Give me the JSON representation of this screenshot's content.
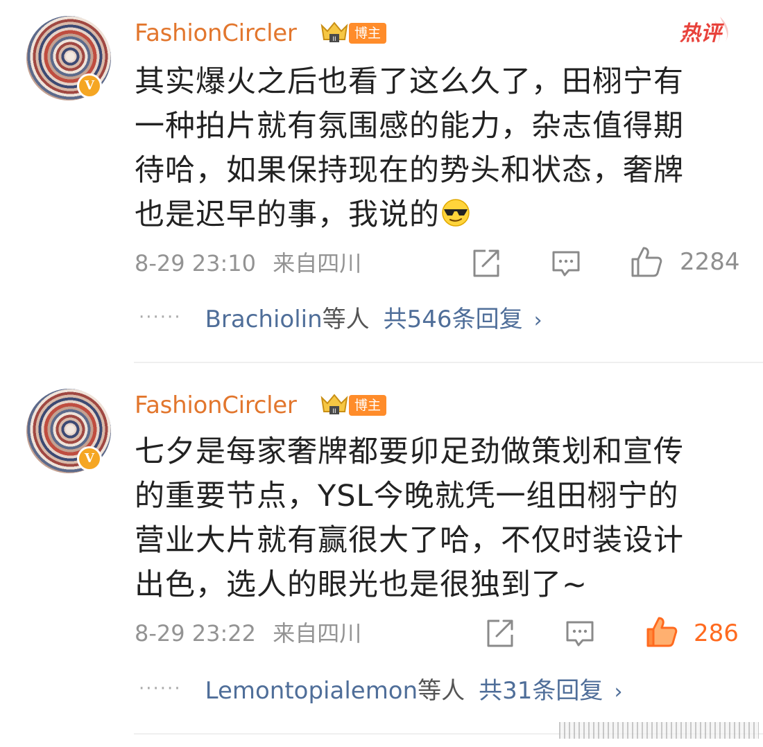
{
  "comments": [
    {
      "username": "FashionCircler",
      "badge": "博主",
      "hot_label": "热评",
      "text": "其实爆火之后也看了这么久了，田栩宁有\n一种拍片就有氛围感的能力，杂志值得期\n待哈，如果保持现在的势头和状态，奢牌\n也是迟早的事，我说的",
      "emoji": "sunglasses-emoji",
      "timestamp": "8-29 23:10",
      "location": "来自四川",
      "likes": "2284",
      "liked": false,
      "replies": {
        "dots": "······",
        "name": "Brachiolin",
        "others": "等人",
        "total": "共546条回复",
        "chevron": "›"
      }
    },
    {
      "username": "FashionCircler",
      "badge": "博主",
      "text": "七夕是每家奢牌都要卯足劲做策划和宣传\n的重要节点，YSL今晚就凭一组田栩宁的\n营业大片就有赢很大了哈，不仅时装设计\n出色，选人的眼光也是很独到了~",
      "timestamp": "8-29 23:22",
      "location": "来自四川",
      "likes": "286",
      "liked": true,
      "replies": {
        "dots": "······",
        "name": "Lemontopialemon",
        "others": "等人",
        "total": "共31条回复",
        "chevron": "›"
      }
    }
  ],
  "colors": {
    "username": "#e2762d",
    "hot": "#e8423b",
    "liked": "#ff6a1f",
    "reply_link": "#4f6e99",
    "meta": "#939393"
  },
  "icons": [
    "verified-v-icon",
    "crown-level-icon",
    "hot-comment-icon",
    "share-icon",
    "comment-icon",
    "thumbs-up-icon"
  ]
}
